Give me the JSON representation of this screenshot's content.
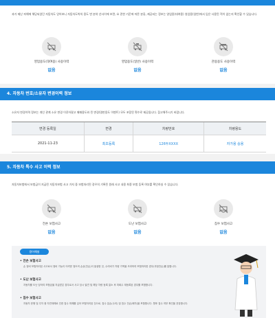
{
  "section3": {
    "intro": "과거 제난 피해에 해당되었던 자동차도 엉어보니 자동차도박의 용도 변 분야 선사이에 보면, 요 관한 기준에 따른 분류, 제공되는 정보는 영업용(대여용) 영업용(일반)에서 입은 사용된 적이 없는지 확인할 수 있습니다.",
    "items": [
      {
        "label": "영업용도(대여용) 사용이력",
        "value": "없음",
        "icon": "rental-car-icon"
      },
      {
        "label": "영업용도(일반) 사용이력",
        "value": "없음",
        "icon": "taxi-car-icon"
      },
      {
        "label": "관용용도 사용이력",
        "value": "없음",
        "icon": "government-car-icon"
      }
    ]
  },
  "section4": {
    "title": "4. 자동차 번호/소유자 변경이력 정보",
    "intro": "소유자 변경이력 정보는 개인 관계 소유 변경 이루어졌고 매매용도와 된 변경(명판용도 이벤트) 모두 포함된 횟수로 제공됩니다. 참고해주시기 바랍니다.",
    "table": {
      "headers": [
        "변경 등록일",
        "변경",
        "차량번호",
        "차량용도"
      ],
      "rows": [
        [
          "2021-11-23",
          "최초등록",
          "126두XXXX",
          "자가용 승용"
        ]
      ]
    }
  },
  "section5": {
    "title": "5. 자동차 특수 사고 이력 정보",
    "intro": "자동차보험에서 보험금이 지급된 자동차보험 사고 가지 중 보험처리된 경우의 기록된 원래 사고 내용 최종 보험 등록 여부를 확인하실 수 있습니다.",
    "items": [
      {
        "label": "전손 보험사고",
        "value": "없음",
        "icon": "total-loss-car-icon"
      },
      {
        "label": "도난 보험사고",
        "value": "없음",
        "icon": "stolen-car-icon"
      },
      {
        "label": "침수 보험사고",
        "value": "없음",
        "icon": "flooded-car-icon"
      }
    ],
    "notes": {
      "badge": "용어해설",
      "items": [
        {
          "title": "• 전손 보험사고",
          "desc": "손 정비 보험처리된 사고로서 정비 가능이 어려운 정도의 손상(전손)이 발생한 것, 수리비가 차량 가액을 초과하여 보험처리한 경우(추정전손)를 말합니다."
        },
        {
          "title": "• 도난 보험사고",
          "desc": "자동차를 도난 당하여 보험금을 지급받은 경우로서 사고 당시 발견 및 해당 차량 등록 말소 후 미회수 재등록된 경우를 포함합니다."
        },
        {
          "title": "• 침수 보험사고",
          "desc": "자동차 운행 및 주차 중 자연재해로 인한 침수 피해를 입어 보험처리된 것으로, 침수 분손(수리) 및 침수 전손(폐차)을 포함합니다. 향후 침수 여부 확인을 권장합니다."
        }
      ]
    }
  }
}
